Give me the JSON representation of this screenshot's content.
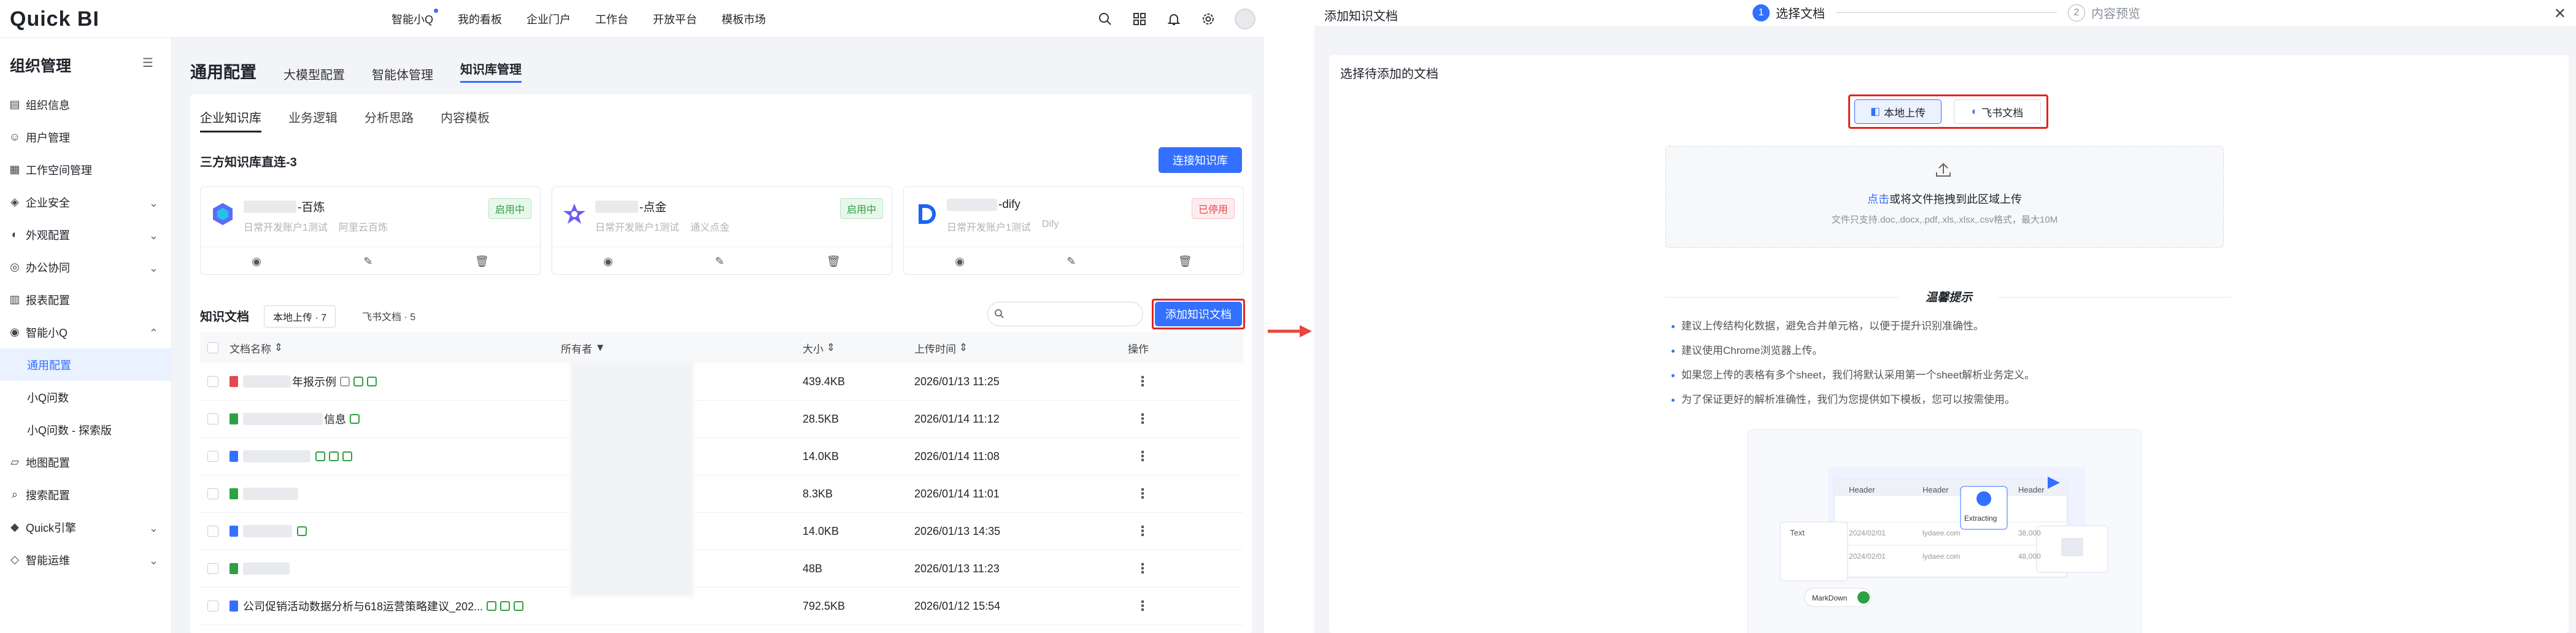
{
  "app": {
    "logo": "Quick BI"
  },
  "topnav": [
    "智能小Q",
    "我的看板",
    "企业门户",
    "工作台",
    "开放平台",
    "模板市场"
  ],
  "sidebar": {
    "title": "组织管理",
    "items": [
      {
        "label": "组织信息",
        "icon": "building-icon"
      },
      {
        "label": "用户管理",
        "icon": "user-icon"
      },
      {
        "label": "工作空间管理",
        "icon": "workspace-icon"
      },
      {
        "label": "企业安全",
        "icon": "shield-icon",
        "chevron": true
      },
      {
        "label": "外观配置",
        "icon": "palette-icon",
        "chevron": true
      },
      {
        "label": "办公协同",
        "icon": "collab-icon",
        "chevron": true
      },
      {
        "label": "报表配置",
        "icon": "report-icon"
      },
      {
        "label": "智能小Q",
        "icon": "bot-icon",
        "chevron": true,
        "expanded": true
      },
      {
        "label": "通用配置",
        "sub": true,
        "active": true
      },
      {
        "label": "小Q问数",
        "sub": true
      },
      {
        "label": "小Q问数 - 探索版",
        "sub": true
      },
      {
        "label": "地图配置",
        "icon": "map-icon"
      },
      {
        "label": "搜索配置",
        "icon": "search-config-icon"
      },
      {
        "label": "Quick引擎",
        "icon": "engine-icon",
        "chevron": true
      },
      {
        "label": "智能运维",
        "icon": "ops-icon",
        "chevron": true
      }
    ]
  },
  "main": {
    "tabs": [
      "通用配置",
      "大模型配置",
      "智能体管理",
      "知识库管理"
    ],
    "subtabs": [
      "企业知识库",
      "业务逻辑",
      "分析思路",
      "内容模板"
    ],
    "section_title": "三方知识库直连-3",
    "connect_button": "连接知识库",
    "kb_cards": [
      {
        "name_suffix": "-百炼",
        "sub1": "日常开发账户1测试",
        "sub2": "阿里云百炼",
        "status": "启用中",
        "on": true
      },
      {
        "name_suffix": "-点金",
        "sub1": "日常开发账户1测试",
        "sub2": "通义点金",
        "status": "启用中",
        "on": true
      },
      {
        "name_suffix": "-dify",
        "sub1": "日常开发账户1测试",
        "sub2": "Dify",
        "status": "已停用",
        "on": false
      }
    ],
    "docs_title": "知识文档",
    "doc_pills": [
      "本地上传 · 7",
      "飞书文档 · 5"
    ],
    "add_doc_button": "添加知识文档",
    "columns": [
      "文档名称",
      "所有者",
      "大小",
      "上传时间",
      "操作"
    ],
    "rows": [
      {
        "name": "年报示例",
        "type": "pdf",
        "size": "439.4KB",
        "time": "2026/01/13 11:25"
      },
      {
        "name": "信息",
        "type": "xls",
        "size": "28.5KB",
        "time": "2026/01/14 11:12"
      },
      {
        "name": "",
        "type": "doc",
        "size": "14.0KB",
        "time": "2026/01/14 11:08"
      },
      {
        "name": "",
        "type": "xls",
        "size": "8.3KB",
        "time": "2026/01/14 11:01"
      },
      {
        "name": "",
        "type": "doc",
        "size": "14.0KB",
        "time": "2026/01/13 14:35"
      },
      {
        "name": "",
        "type": "csv",
        "size": "48B",
        "time": "2026/01/13 11:23"
      },
      {
        "name": "公司促销活动数据分析与618运营策略建议_202...",
        "type": "doc",
        "size": "792.5KB",
        "time": "2026/01/12 15:54"
      }
    ]
  },
  "dialog": {
    "title": "添加知识文档",
    "step1": "选择文档",
    "step2": "内容预览",
    "section": "选择待添加的文档",
    "btn_local": "本地上传",
    "btn_feishu": "飞书文档",
    "upload_link": "点击",
    "upload_text": "或将文件拖拽到此区域上传",
    "upload_hint": "文件只支持.doc,.docx,.pdf,.xls,.xlsx,.csv格式，最大10M",
    "tips_title": "温馨提示",
    "tips": [
      "建议上传结构化数据，避免合并单元格，以便于提升识别准确性。",
      "建议使用Chrome浏览器上传。",
      "如果您上传的表格有多个sheet，我们将默认采用第一个sheet解析业务定义。",
      "为了保证更好的解析准确性，我们为您提供如下模板，您可以按需使用。"
    ],
    "illus": {
      "header": "Header",
      "text": "Text",
      "date1": "2024/02/01",
      "date2": "2024/02/01",
      "cell": "lydaee.com",
      "num1": "38,000",
      "num2": "48,000",
      "extracting": "Extracting",
      "markdown": "MarkDown"
    }
  },
  "colors": {
    "accent": "#3370ff",
    "highlight": "#e02424"
  }
}
